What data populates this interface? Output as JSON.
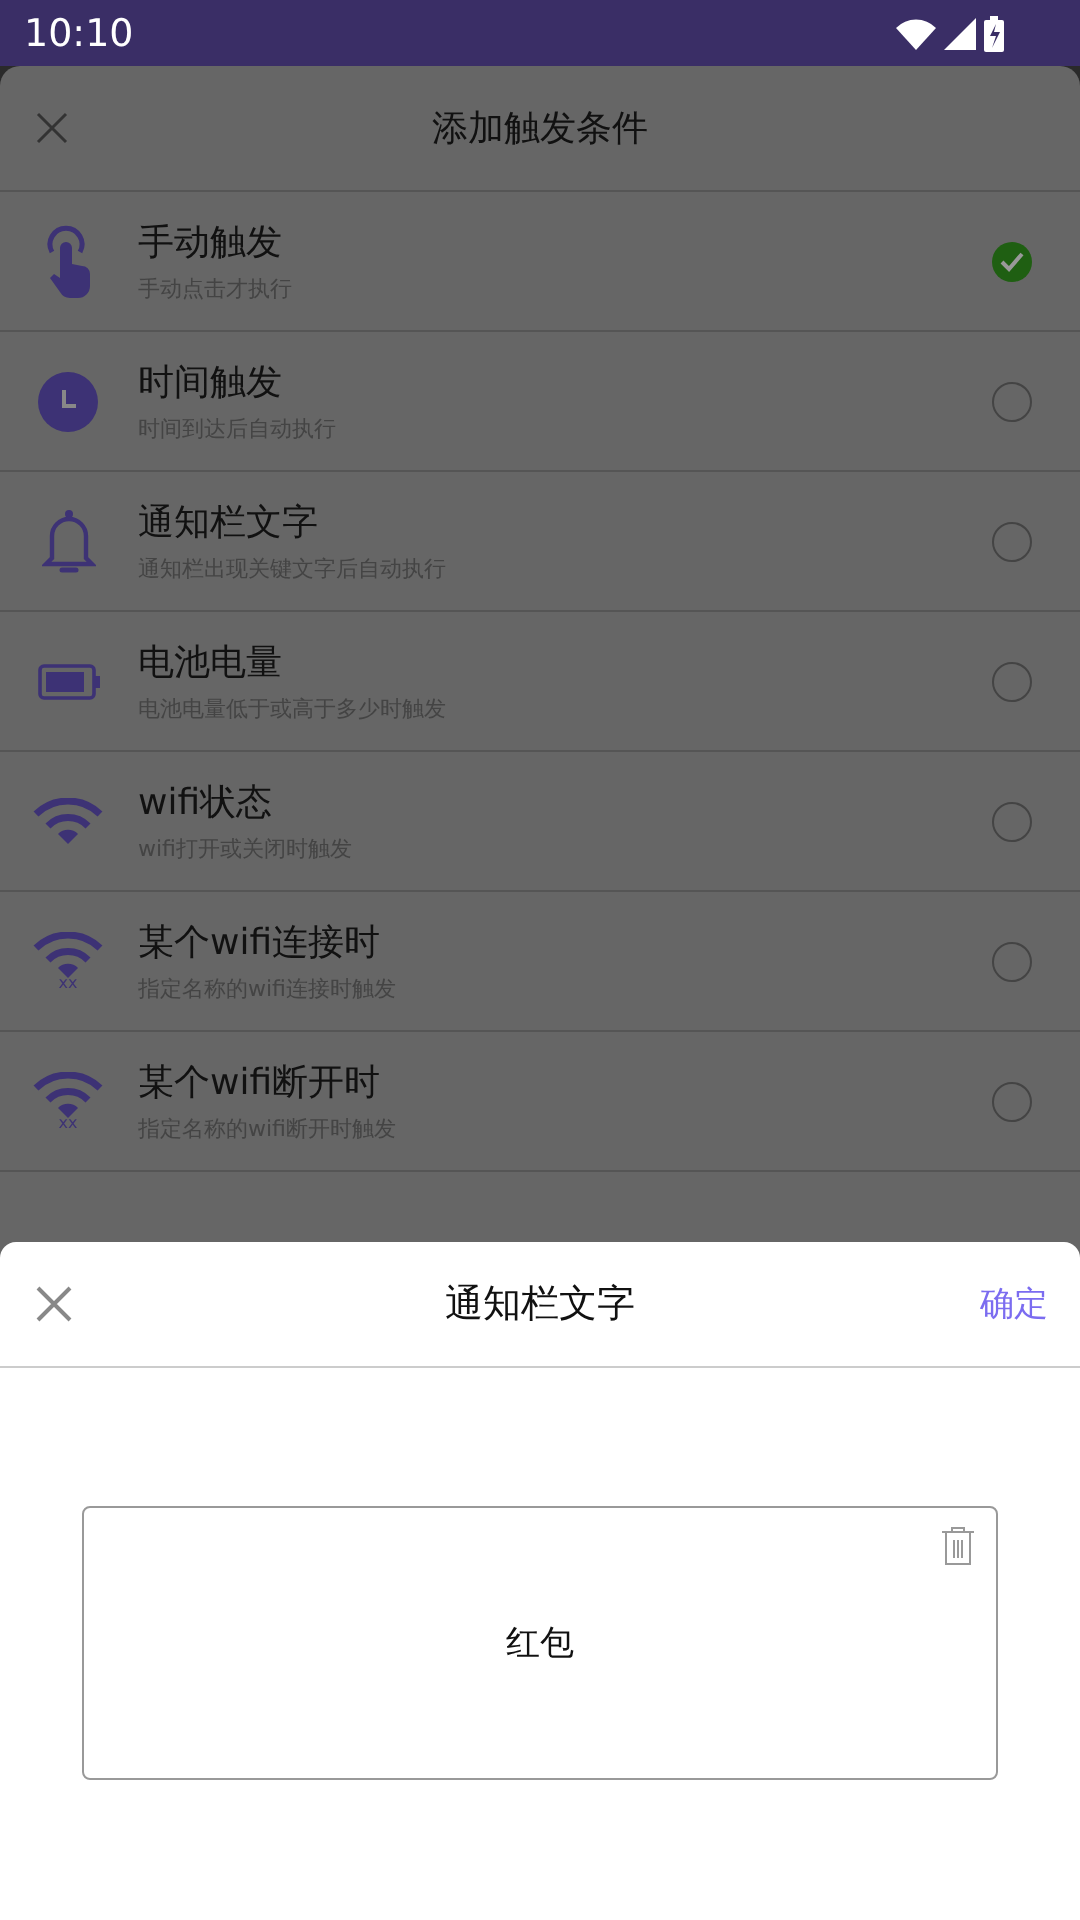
{
  "status_bar": {
    "time": "10:10"
  },
  "dialog": {
    "title": "添加触发条件",
    "items": [
      {
        "kind": "hand",
        "title": "手动触发",
        "subtitle": "手动点击才执行",
        "selected": true
      },
      {
        "kind": "clock",
        "title": "时间触发",
        "subtitle": "时间到达后自动执行",
        "selected": false
      },
      {
        "kind": "bell",
        "title": "通知栏文字",
        "subtitle": "通知栏出现关键文字后自动执行",
        "selected": false
      },
      {
        "kind": "battery",
        "title": "电池电量",
        "subtitle": "电池电量低于或高于多少时触发",
        "selected": false
      },
      {
        "kind": "wifi",
        "title": "wifi状态",
        "subtitle": "wifi打开或关闭时触发",
        "selected": false
      },
      {
        "kind": "wifi",
        "icon_label": "xx",
        "title": "某个wifi连接时",
        "subtitle": "指定名称的wifi连接时触发",
        "selected": false
      },
      {
        "kind": "wifi",
        "icon_label": "xx",
        "title": "某个wifi断开时",
        "subtitle": "指定名称的wifi断开时触发",
        "selected": false
      }
    ]
  },
  "sheet": {
    "title": "通知栏文字",
    "confirm": "确定",
    "keyword": "红包"
  }
}
